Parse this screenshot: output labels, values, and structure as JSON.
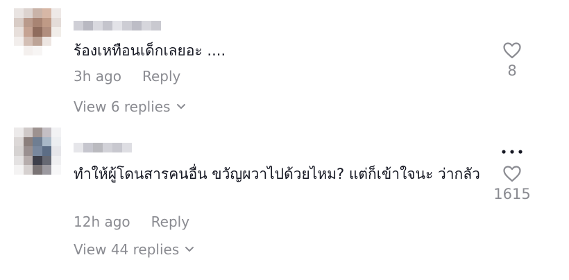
{
  "comments": [
    {
      "text": "ร้องเหทือนเด็กเลยอะ ....",
      "time": "3h ago",
      "reply_label": "Reply",
      "view_replies": "View 6 replies",
      "likes": "8"
    },
    {
      "text": "ทำให้ผู้โดนสารคนอื่น ขวัญผวาไปด้วยไหม? แต่ก็เข้าใจนะ ว่ากลัว",
      "time": "12h ago",
      "reply_label": "Reply",
      "view_replies": "View 44 replies",
      "likes": "1615"
    }
  ],
  "icons": {
    "like": "heart-outline-icon",
    "expand": "chevron-down-icon",
    "more": "more-options-icon"
  },
  "colors": {
    "text": "#161823",
    "muted": "#8a8b91"
  }
}
